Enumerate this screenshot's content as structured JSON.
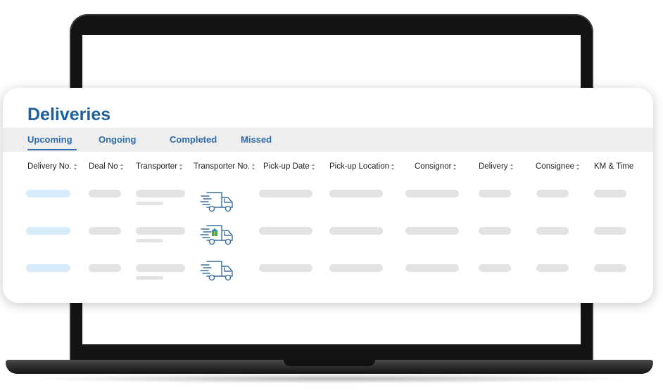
{
  "page": {
    "title": "Deliveries",
    "accent_color": "#1f5f99"
  },
  "tabs": [
    "Upcoming",
    "Ongoing",
    "Completed",
    "Missed"
  ],
  "active_tab": "Upcoming",
  "columns": [
    "Delivery No.",
    "Deal No",
    "Transporter",
    "Transporter No.",
    "Pick-up Date",
    "Pick-up Location",
    "Consignor",
    "Delivery",
    "Consignee",
    "KM & Time"
  ],
  "rows": [
    {
      "transporter_icon": "delivery-truck-icon"
    },
    {
      "transporter_icon": "delivery-truck-with-box-icon"
    },
    {
      "transporter_icon": "delivery-truck-icon"
    }
  ]
}
